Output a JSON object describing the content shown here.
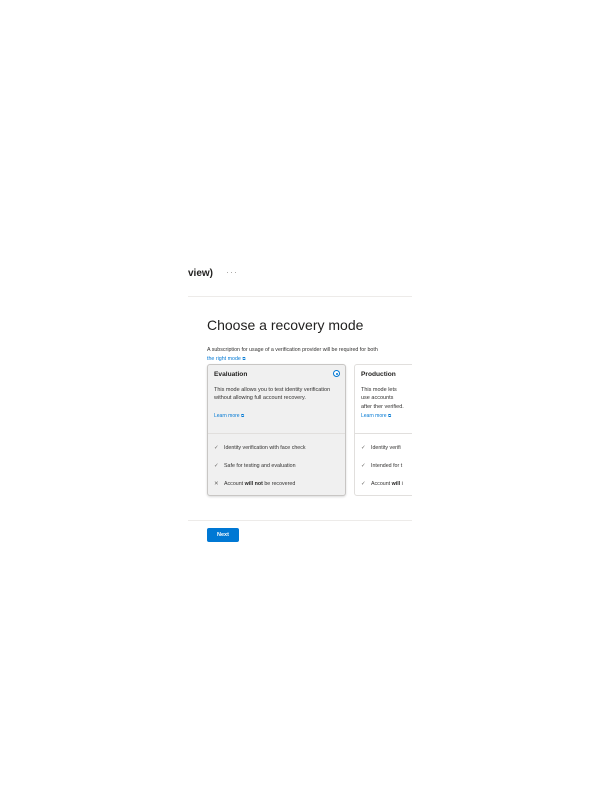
{
  "header": {
    "title": "view)",
    "ellipsis": "···"
  },
  "page": {
    "title": "Choose a recovery mode",
    "description": "A subscription for usage of a verification provider will be required for both",
    "link_label": "the right mode",
    "link_icon": "⧉"
  },
  "cards": [
    {
      "title": "Evaluation",
      "selected": true,
      "description": "This mode allows you to test identity verification without allowing full account recovery.",
      "link_label": "Learn more",
      "link_icon": "⧉",
      "features": [
        {
          "mark": "✓",
          "icon_name": "check-icon",
          "pre": "Identity verification with face check",
          "bold": "",
          "post": ""
        },
        {
          "mark": "✓",
          "icon_name": "check-icon",
          "pre": "Safe for testing and evaluation",
          "bold": "",
          "post": ""
        },
        {
          "mark": "✕",
          "icon_name": "cross-icon",
          "pre": "Account ",
          "bold": "will not",
          "post": " be recovered"
        }
      ]
    },
    {
      "title": "Production",
      "selected": false,
      "description": "This mode lets use accounts after ther verified.",
      "link_label": "Learn more",
      "link_icon": "⧉",
      "features": [
        {
          "mark": "✓",
          "icon_name": "check-icon",
          "pre": "Identity verifi",
          "bold": "",
          "post": ""
        },
        {
          "mark": "✓",
          "icon_name": "check-icon",
          "pre": "Intended for t",
          "bold": "",
          "post": ""
        },
        {
          "mark": "✓",
          "icon_name": "check-icon",
          "pre": "Account ",
          "bold": "will",
          "post": " i"
        }
      ]
    }
  ],
  "footer": {
    "next_label": "Next"
  },
  "colors": {
    "accent": "#0078d4",
    "selected_card_bg": "#f0f0f0",
    "text": "#323130"
  }
}
